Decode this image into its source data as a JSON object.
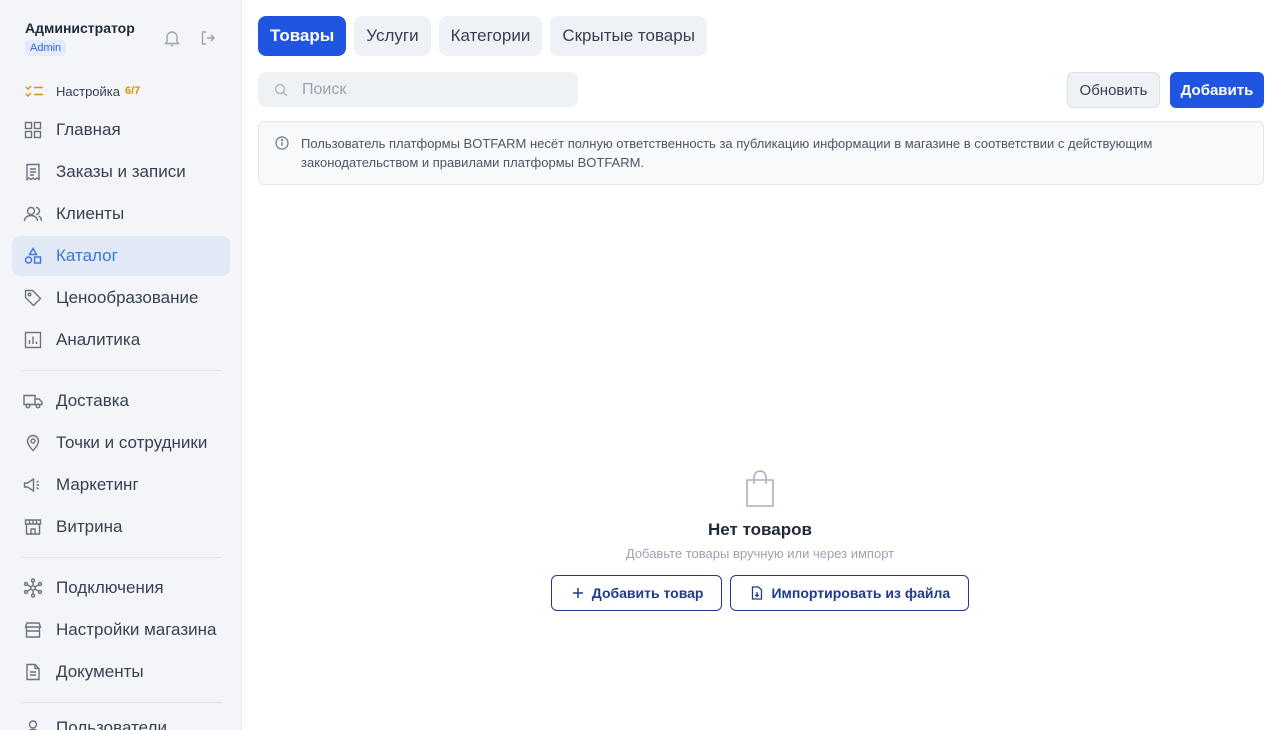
{
  "user": {
    "name": "Администратор",
    "role": "Admin"
  },
  "setup": {
    "label": "Настройка",
    "progress": "6/7"
  },
  "sidebar": {
    "items": [
      {
        "label": "Главная",
        "icon": "grid-icon"
      },
      {
        "label": "Заказы и записи",
        "icon": "receipt-icon"
      },
      {
        "label": "Клиенты",
        "icon": "users-icon"
      },
      {
        "label": "Каталог",
        "icon": "shapes-icon",
        "active": true
      },
      {
        "label": "Ценообразование",
        "icon": "tag-icon"
      },
      {
        "label": "Аналитика",
        "icon": "chart-icon"
      },
      {
        "label": "Доставка",
        "icon": "truck-icon"
      },
      {
        "label": "Точки и сотрудники",
        "icon": "map-pin-icon"
      },
      {
        "label": "Маркетинг",
        "icon": "megaphone-icon"
      },
      {
        "label": "Витрина",
        "icon": "storefront-icon"
      },
      {
        "label": "Подключения",
        "icon": "network-icon"
      },
      {
        "label": "Настройки магазина",
        "icon": "store-icon"
      },
      {
        "label": "Документы",
        "icon": "document-icon"
      },
      {
        "label": "Пользователи",
        "icon": "user-icon"
      }
    ]
  },
  "tabs": [
    {
      "label": "Товары",
      "active": true
    },
    {
      "label": "Услуги"
    },
    {
      "label": "Категории"
    },
    {
      "label": "Скрытые товары"
    }
  ],
  "search": {
    "placeholder": "Поиск",
    "value": ""
  },
  "toolbar": {
    "refresh_label": "Обновить",
    "add_label": "Добавить"
  },
  "notice": {
    "text": "Пользователь платформы BOTFARM несёт полную ответственность за публикацию информации в магазине в соответствии с действующим законодательством и правилами платформы BOTFARM."
  },
  "empty": {
    "title": "Нет товаров",
    "subtitle": "Добавьте товары вручную или через импорт",
    "add_label": "Добавить товар",
    "import_label": "Импортировать из файла"
  },
  "colors": {
    "accent": "#1f55e0",
    "active_nav_bg": "#e1e9f6",
    "active_nav_text": "#3b76d8",
    "setup_count": "#d99500"
  }
}
